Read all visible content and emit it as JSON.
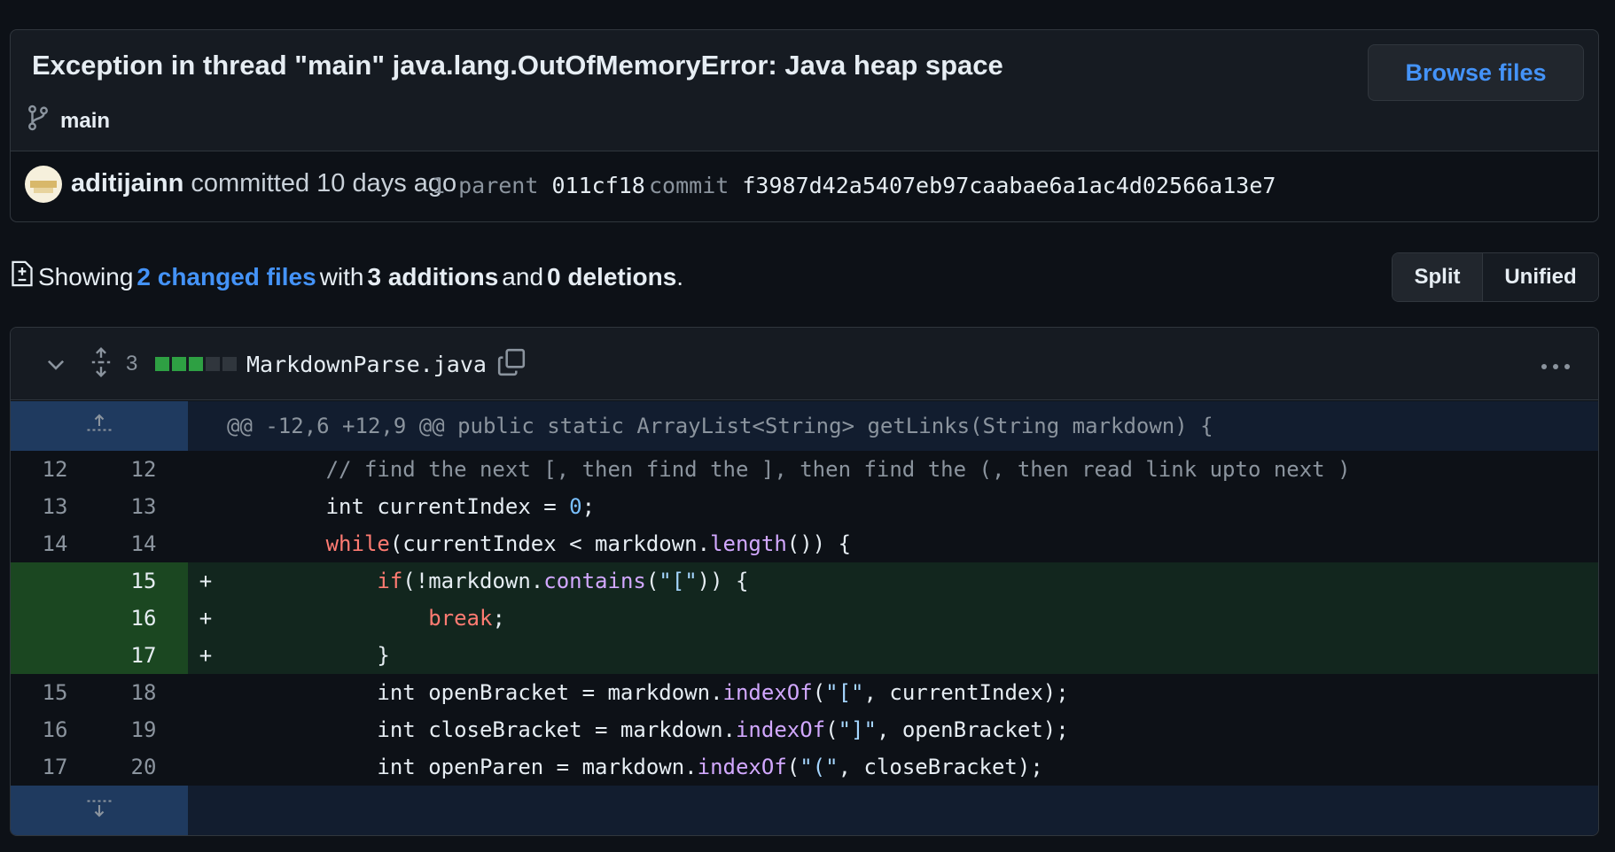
{
  "commit": {
    "title": "Exception in thread \"main\" java.lang.OutOfMemoryError: Java heap space",
    "browse_files_label": "Browse files",
    "branch": "main",
    "author": "aditijainn",
    "committed_text": " committed 10 days ago",
    "parent_label": "1 parent",
    "parent_hash": "011cf18",
    "commit_label": "commit",
    "commit_hash": "f3987d42a5407eb97caabae6a1ac4d02566a13e7"
  },
  "summary": {
    "showing": "Showing",
    "changed_files": "2 changed files",
    "with": "with",
    "additions": "3 additions",
    "and": "and",
    "deletions": "0 deletions",
    "period": "."
  },
  "view_toggle": {
    "split": "Split",
    "unified": "Unified"
  },
  "file": {
    "change_count": "3",
    "diffstat_colors": [
      "#2ea043",
      "#2ea043",
      "#2ea043",
      "#30363d",
      "#30363d"
    ],
    "name": "MarkdownParse.java",
    "hunk_header": "@@ -12,6 +12,9 @@ public static ArrayList<String> getLinks(String markdown) {"
  },
  "diff_lines": [
    {
      "type": "ctx",
      "old": "12",
      "new": "12",
      "sign": " ",
      "tokens": [
        {
          "t": "        "
        },
        {
          "t": "// find the next [, then find the ], then find the (, then read link upto next )",
          "c": "cmt"
        }
      ]
    },
    {
      "type": "ctx",
      "old": "13",
      "new": "13",
      "sign": " ",
      "tokens": [
        {
          "t": "        int currentIndex = "
        },
        {
          "t": "0",
          "c": "num"
        },
        {
          "t": ";"
        }
      ]
    },
    {
      "type": "ctx",
      "old": "14",
      "new": "14",
      "sign": " ",
      "tokens": [
        {
          "t": "        "
        },
        {
          "t": "while",
          "c": "kw"
        },
        {
          "t": "(currentIndex < markdown."
        },
        {
          "t": "length",
          "c": "fn"
        },
        {
          "t": "()) {"
        }
      ]
    },
    {
      "type": "add",
      "old": "",
      "new": "15",
      "sign": "+",
      "tokens": [
        {
          "t": "            "
        },
        {
          "t": "if",
          "c": "kw"
        },
        {
          "t": "(!markdown."
        },
        {
          "t": "contains",
          "c": "fn"
        },
        {
          "t": "("
        },
        {
          "t": "\"[\"",
          "c": "str"
        },
        {
          "t": ")) {"
        }
      ]
    },
    {
      "type": "add",
      "old": "",
      "new": "16",
      "sign": "+",
      "tokens": [
        {
          "t": "                "
        },
        {
          "t": "break",
          "c": "kw"
        },
        {
          "t": ";"
        }
      ]
    },
    {
      "type": "add",
      "old": "",
      "new": "17",
      "sign": "+",
      "tokens": [
        {
          "t": "            }"
        }
      ]
    },
    {
      "type": "ctx",
      "old": "15",
      "new": "18",
      "sign": " ",
      "tokens": [
        {
          "t": "            int openBracket = markdown."
        },
        {
          "t": "indexOf",
          "c": "fn"
        },
        {
          "t": "("
        },
        {
          "t": "\"[\"",
          "c": "str"
        },
        {
          "t": ", currentIndex);"
        }
      ]
    },
    {
      "type": "ctx",
      "old": "16",
      "new": "19",
      "sign": " ",
      "tokens": [
        {
          "t": "            int closeBracket = markdown."
        },
        {
          "t": "indexOf",
          "c": "fn"
        },
        {
          "t": "("
        },
        {
          "t": "\"]\"",
          "c": "str"
        },
        {
          "t": ", openBracket);"
        }
      ]
    },
    {
      "type": "ctx",
      "old": "17",
      "new": "20",
      "sign": " ",
      "tokens": [
        {
          "t": "            int openParen = markdown."
        },
        {
          "t": "indexOf",
          "c": "fn"
        },
        {
          "t": "("
        },
        {
          "t": "\"(\"",
          "c": "str"
        },
        {
          "t": ", closeBracket);"
        }
      ]
    }
  ]
}
